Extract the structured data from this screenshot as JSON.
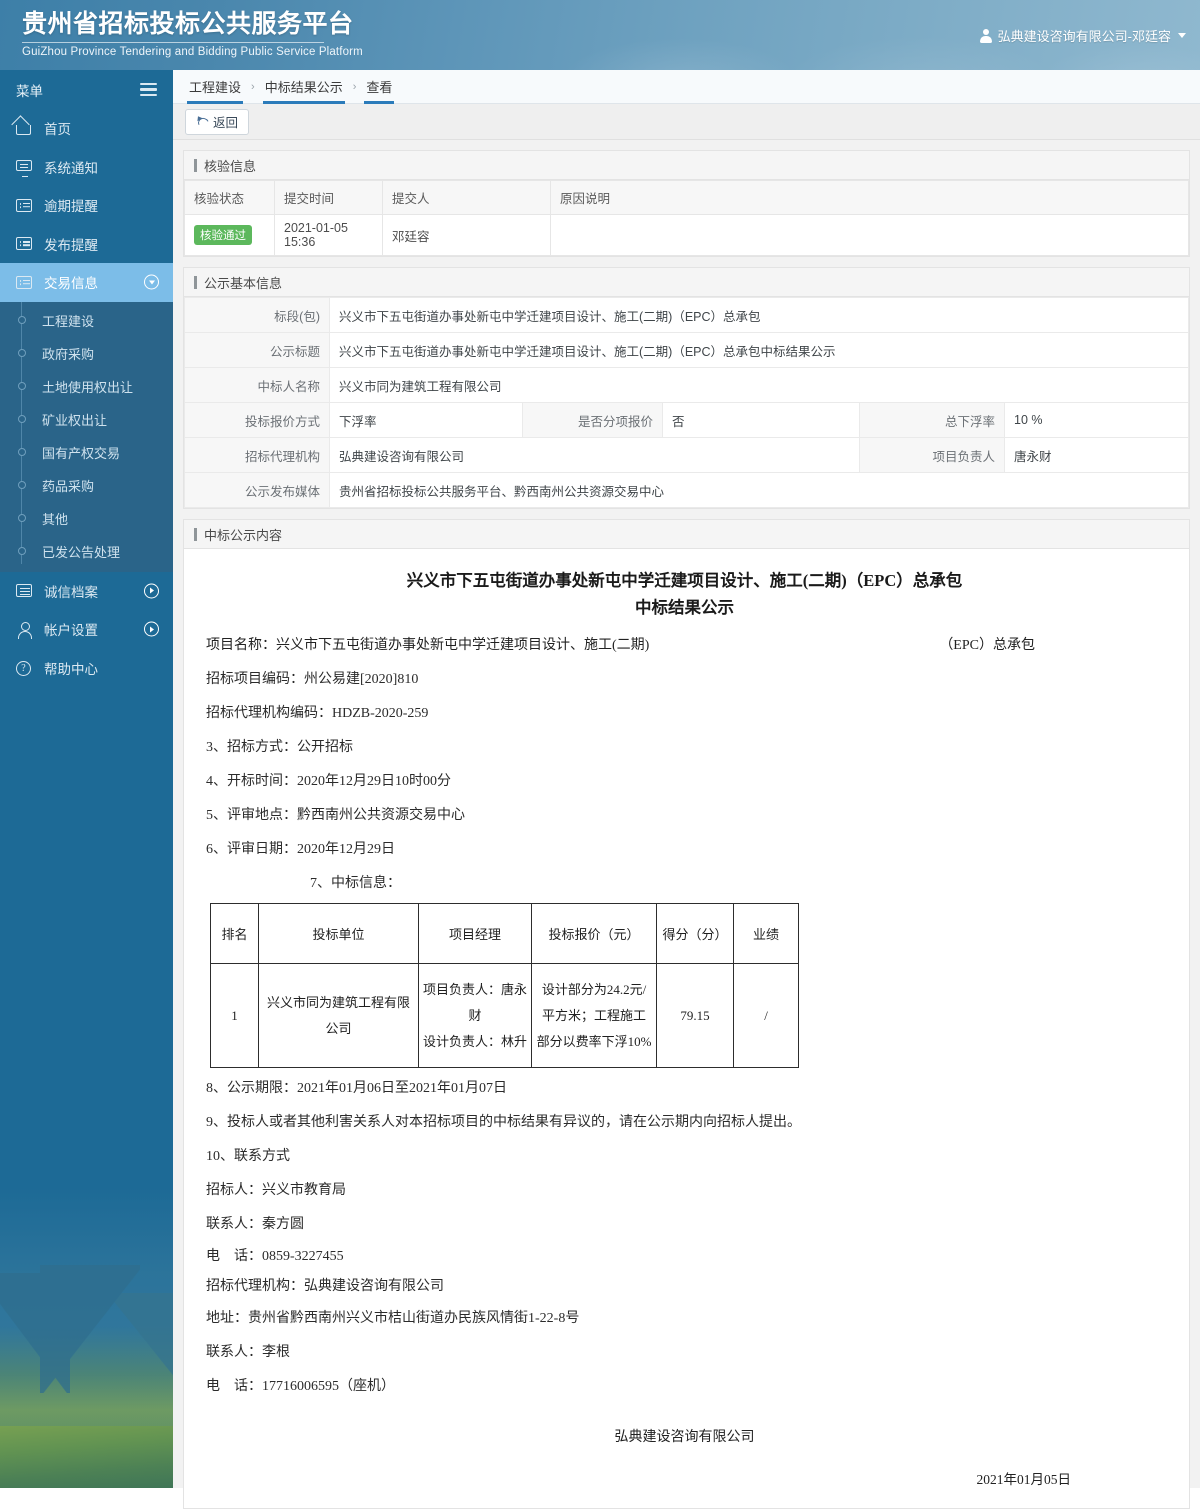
{
  "header": {
    "title_cn": "贵州省招标投标公共服务平台",
    "title_en": "GuiZhou Province Tendering and Bidding Public Service Platform",
    "user": "弘典建设咨询有限公司-邓廷容",
    "user_icon": "user-icon",
    "caret_icon": "chevron-down-icon"
  },
  "sidebar": {
    "menu_label": "菜单",
    "hamburger_icon": "hamburger-icon",
    "items": [
      {
        "label": "首页",
        "icon": "home-icon"
      },
      {
        "label": "系统通知",
        "icon": "monitor-icon"
      },
      {
        "label": "逾期提醒",
        "icon": "list-icon"
      },
      {
        "label": "发布提醒",
        "icon": "list-icon"
      },
      {
        "label": "交易信息",
        "icon": "list-icon",
        "expanded": true,
        "arrow_icon": "chevron-down-circle-icon"
      }
    ],
    "sub_items": [
      {
        "label": "工程建设"
      },
      {
        "label": "政府采购"
      },
      {
        "label": "土地使用权出让"
      },
      {
        "label": "矿业权出让"
      },
      {
        "label": "国有产权交易"
      },
      {
        "label": "药品采购"
      },
      {
        "label": "其他"
      },
      {
        "label": "已发公告处理"
      }
    ],
    "items_bottom": [
      {
        "label": "诚信档案",
        "icon": "grid-icon",
        "arrow_icon": "chevron-right-circle-icon"
      },
      {
        "label": "帐户设置",
        "icon": "user-icon",
        "arrow_icon": "chevron-right-circle-icon"
      },
      {
        "label": "帮助中心",
        "icon": "help-icon"
      }
    ]
  },
  "breadcrumb": {
    "items": [
      "工程建设",
      "中标结果公示",
      "查看"
    ],
    "separator": "›"
  },
  "toolbar": {
    "back_label": "返回",
    "back_icon": "undo-icon"
  },
  "verify_panel": {
    "title": "核验信息",
    "columns": [
      "核验状态",
      "提交时间",
      "提交人",
      "原因说明"
    ],
    "rows": [
      {
        "status": "核验通过",
        "submit_time": "2021-01-05 15:36",
        "submitter": "邓廷容",
        "reason": ""
      }
    ]
  },
  "basic_panel": {
    "title": "公示基本信息",
    "fields": {
      "section_label": "标段(包)",
      "section_value": "兴义市下五屯街道办事处新屯中学迁建项目设计、施工(二期)（EPC）总承包",
      "notice_title_label": "公示标题",
      "notice_title_value": "兴义市下五屯街道办事处新屯中学迁建项目设计、施工(二期)（EPC）总承包中标结果公示",
      "winner_label": "中标人名称",
      "winner_value": "兴义市同为建筑工程有限公司",
      "quote_type_label": "投标报价方式",
      "quote_type_value": "下浮率",
      "itemized_label": "是否分项报价",
      "itemized_value": "否",
      "total_discount_label": "总下浮率",
      "total_discount_value": "10 %",
      "agency_label": "招标代理机构",
      "agency_value": "弘典建设咨询有限公司",
      "manager_label": "项目负责人",
      "manager_value": "唐永财",
      "media_label": "公示发布媒体",
      "media_value": "贵州省招标投标公共服务平台、黔西南州公共资源交易中心"
    }
  },
  "content_panel": {
    "title": "中标公示内容",
    "doc_title_line1": "兴义市下五屯街道办事处新屯中学迁建项目设计、施工(二期)（EPC）总承包",
    "doc_title_line2": "中标结果公示",
    "project_name_left": "项目名称：兴义市下五屯街道办事处新屯中学迁建项目设计、施工(二期)",
    "project_name_right": "（EPC）总承包",
    "line_project_code": "招标项目编码：州公易建[2020]810",
    "line_agency_code": "招标代理机构编码：HDZB-2020-259",
    "line_3": "3、招标方式：公开招标",
    "line_4": "4、开标时间：2020年12月29日10时00分",
    "line_5": "5、评审地点：黔西南州公共资源交易中心",
    "line_6": "6、评审日期：2020年12月29日",
    "line_7": "7、中标信息：",
    "bid_table": {
      "columns": [
        "排名",
        "投标单位",
        "项目经理",
        "投标报价（元）",
        "得分（分）",
        "业绩"
      ],
      "rows": [
        {
          "rank": "1",
          "bidder": "兴义市同为建筑工程有限公司",
          "manager": "项目负责人：唐永财\n设计负责人：林升",
          "price": "设计部分为24.2元/平方米；工程施工部分以费率下浮10%",
          "score": "79.15",
          "performance": "/"
        }
      ]
    },
    "line_8": "8、公示期限：2021年01月06日至2021年01月07日",
    "line_9": "9、投标人或者其他利害关系人对本招标项目的中标结果有异议的，请在公示期内向招标人提出。",
    "line_10": "10、联系方式",
    "line_tenderer": "招标人：兴义市教育局",
    "line_contact1": "联系人：秦方圆",
    "line_phone1": "电　话：0859-3227455",
    "line_agency": "招标代理机构：弘典建设咨询有限公司",
    "line_address": "地址：贵州省黔西南州兴义市桔山街道办民族风情街1-22-8号",
    "line_contact2": "联系人：李根",
    "line_phone2": "电　话：17716006595（座机）",
    "sign_company": "弘典建设咨询有限公司",
    "sign_date": "2021年01月05日"
  },
  "colors": {
    "header_blue": "#4a87ad",
    "sidebar_blue": "#1d6a96",
    "active_item": "#7cbde8",
    "crumb_underline": "#2b7bba",
    "badge_green": "#5cb85c"
  }
}
